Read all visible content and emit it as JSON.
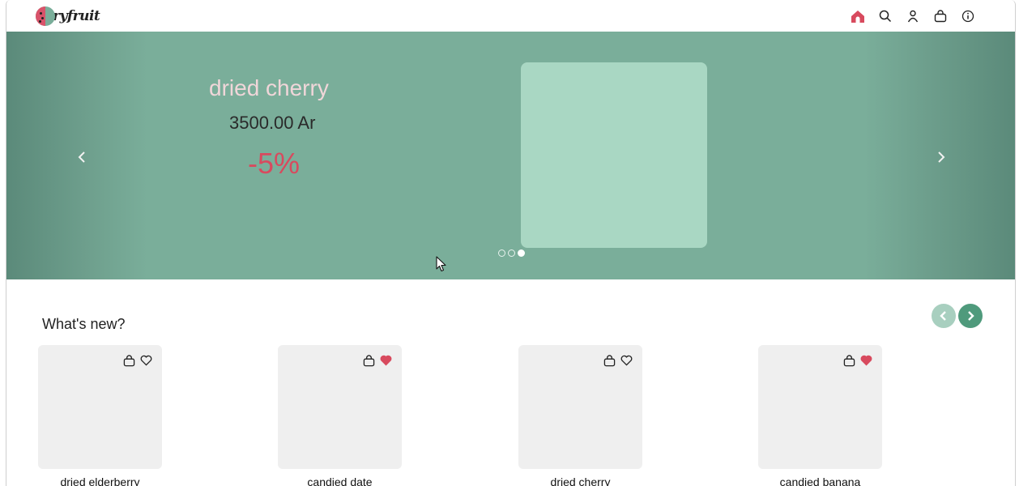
{
  "brand": {
    "logo_text": "ryfruit"
  },
  "nav": {
    "items": [
      {
        "name": "home-icon",
        "active": true
      },
      {
        "name": "search-icon"
      },
      {
        "name": "user-icon"
      },
      {
        "name": "bag-icon"
      },
      {
        "name": "info-icon"
      }
    ]
  },
  "colors": {
    "accent": "#d84a5e",
    "hero_bg": "#7aae9a",
    "hero_image": "#a9d7c3",
    "carousel_next": "#4f9a7c",
    "carousel_prev": "#a8cfbf"
  },
  "hero": {
    "title": "dried cherry",
    "price": "3500.00 Ar",
    "discount": "-5%",
    "slides_count": 3,
    "active_slide": 3
  },
  "whats_new": {
    "title": "What's new?",
    "products": [
      {
        "name": "dried elderberry",
        "liked": false
      },
      {
        "name": "candied date",
        "liked": true
      },
      {
        "name": "dried cherry",
        "liked": false
      },
      {
        "name": "candied banana",
        "liked": true
      }
    ]
  }
}
